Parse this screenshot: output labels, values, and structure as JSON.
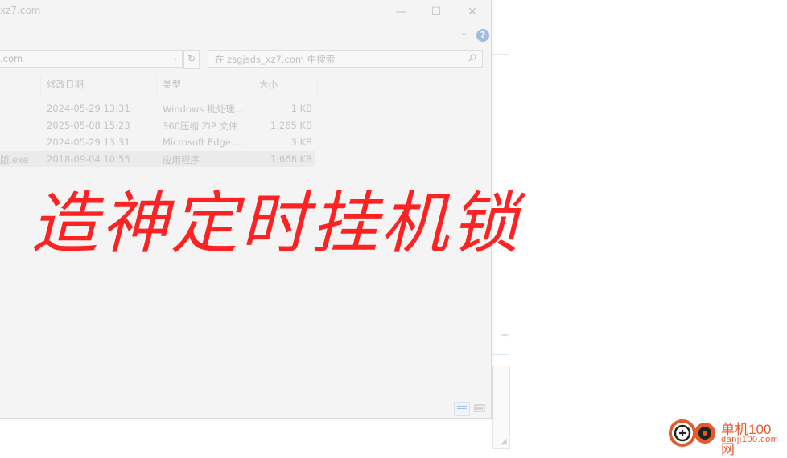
{
  "window": {
    "title": "xz7.com",
    "minimize": "—",
    "maximize": "☐",
    "close": "✕",
    "ribbon_toggle": "⌄",
    "help": "?"
  },
  "address": {
    "value": ".com",
    "dropdown": "⌄",
    "refresh": "↻"
  },
  "search": {
    "placeholder": "在 zsgjsds_xz7.com 中搜索"
  },
  "columns": [
    "修改日期",
    "类型",
    "大小"
  ],
  "files": [
    {
      "name": "",
      "date": "2024-05-29 13:31",
      "type": "Windows 批处理...",
      "size": "1 KB"
    },
    {
      "name": "",
      "date": "2025-05-08 15:23",
      "type": "360压缩 ZIP 文件",
      "size": "1,265 KB"
    },
    {
      "name": "",
      "date": "2024-05-29 13:31",
      "type": "Microsoft Edge ...",
      "size": "3 KB"
    },
    {
      "name": "版.exe",
      "date": "2018-09-04 10:55",
      "type": "应用程序",
      "size": "1,668 KB",
      "selected": true
    }
  ],
  "overlay_title": "造神定时挂机锁",
  "background_plus": "+",
  "watermark": {
    "name": "单机100网",
    "url": "danji100.com"
  },
  "colors": {
    "overlay": "#ff2222",
    "watermark": "#e25b2e",
    "help": "#9fbde0"
  }
}
